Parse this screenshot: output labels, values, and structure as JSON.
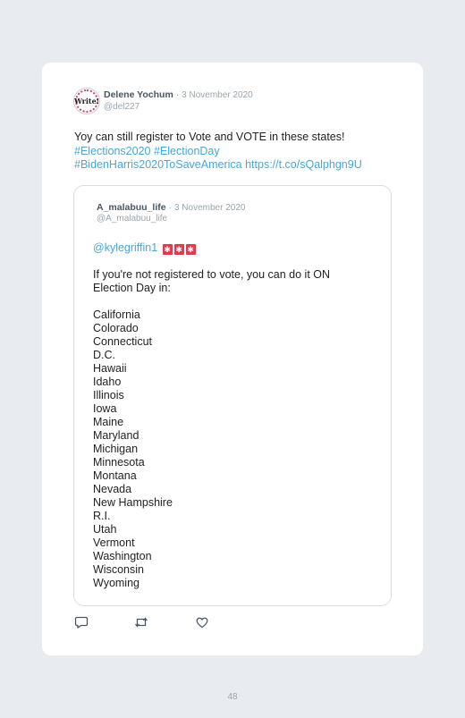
{
  "tweet": {
    "author_name": "Delene Yochum",
    "separator": "·",
    "date": "3 November 2020",
    "handle": "@del227",
    "avatar_text": "Write!",
    "text_plain": "Yoy can still register to Vote and VOTE in these states!",
    "hashtag1": "#Elections2020",
    "hashtag2": "#ElectionDay",
    "hashtag3": "#BidenHarris2020ToSaveAmerica",
    "url": "https://t.co/sQalphgn9U"
  },
  "quoted": {
    "author_name": "A_malabuu_life",
    "separator": "·",
    "date": "3 November 2020",
    "handle": "@A_malabuu_life",
    "mention": "@kylegriffin1",
    "emoji": [
      "✱",
      "✱",
      "✱"
    ],
    "intro": "If you're not registered to vote, you can do it ON Election Day in:",
    "states": [
      "California",
      "Colorado",
      "Connecticut",
      "D.C.",
      "Hawaii",
      "Idaho",
      "Illinois",
      "Iowa",
      "Maine",
      "Maryland",
      "Michigan",
      "Minnesota",
      "Montana",
      "Nevada",
      "New Hampshire",
      "R.I.",
      "Utah",
      "Vermont",
      "Washington",
      "Wisconsin",
      "Wyoming"
    ]
  },
  "actions": {
    "icons": [
      "reply-icon",
      "retweet-icon",
      "like-icon"
    ]
  },
  "page_number": "48",
  "colors": {
    "link": "#4aa6d6",
    "background": "#e8ebef",
    "card": "#ffffff"
  }
}
